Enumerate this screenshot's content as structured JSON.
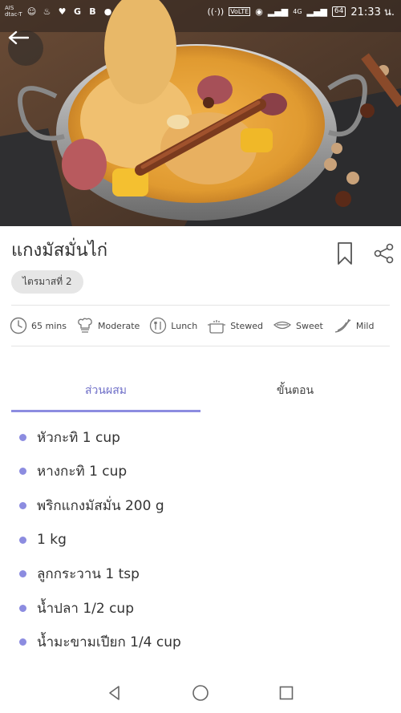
{
  "status_bar": {
    "carrier_line1": "AIS",
    "carrier_line2": "dtac-T",
    "network": "4G",
    "battery": "64",
    "time": "21:33 น."
  },
  "recipe": {
    "title": "แกงมัสมั่นไก่",
    "tag": "ไตรมาสที่ 2"
  },
  "info": {
    "time": "65 mins",
    "difficulty": "Moderate",
    "meal": "Lunch",
    "method": "Stewed",
    "taste": "Sweet",
    "spice": "Mild"
  },
  "tabs": {
    "ingredients": "ส่วนผสม",
    "steps": "ขั้นตอน"
  },
  "ingredients": [
    "หัวกะทิ 1 cup",
    "หางกะทิ 1 cup",
    "พริกแกงมัสมั่น 200 g",
    "1 kg",
    "ลูกกระวาน 1 tsp",
    "น้ำปลา 1/2 cup",
    "น้ำมะขามเปียก 1/4 cup"
  ],
  "colors": {
    "accent": "#8c8ce0",
    "tab_active_text": "#7070c8",
    "tag_bg": "#e6e6e6"
  },
  "icons": {
    "back": "arrow-left-icon",
    "bookmark": "bookmark-icon",
    "share": "share-icon"
  }
}
